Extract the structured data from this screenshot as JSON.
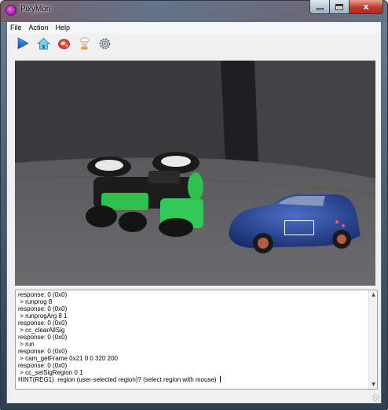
{
  "window": {
    "title": "PixyMon",
    "minimize_icon": "minimize-icon",
    "maximize_icon": "maximize-icon",
    "close_icon": "close-icon",
    "close_glyph": "x"
  },
  "menu": {
    "items": [
      {
        "label": "File"
      },
      {
        "label": "Action"
      },
      {
        "label": "Help"
      }
    ]
  },
  "toolbar": {
    "items": [
      {
        "name": "run-button",
        "icon": "play-icon"
      },
      {
        "name": "home-button",
        "icon": "home-icon"
      },
      {
        "name": "signature-button",
        "icon": "steak-icon"
      },
      {
        "name": "cook-button",
        "icon": "chef-icon"
      },
      {
        "name": "configure-button",
        "icon": "gear-icon"
      }
    ]
  },
  "video": {
    "description": "camera-feed",
    "roi_color": "#ffffff"
  },
  "console": {
    "lines": [
      "response: 0 (0x0)",
      " > runprog 8",
      "response: 0 (0x0)",
      " > runprogArg 8 1",
      "response: 0 (0x0)",
      " > cc_clearAllSig",
      "response: 0 (0x0)",
      " > run",
      "response: 0 (0x0)",
      " > cam_getFrame 0x21 0 0 320 200",
      "response: 0 (0x0)",
      " > cc_setSigRegion 0 1",
      "HINT(REG1)  region (user-selected region)? (select region with mouse) "
    ]
  },
  "colors": {
    "accent": "#1a73c9",
    "console_bg": "#ffffff",
    "client_bg": "#f0f0f0"
  }
}
